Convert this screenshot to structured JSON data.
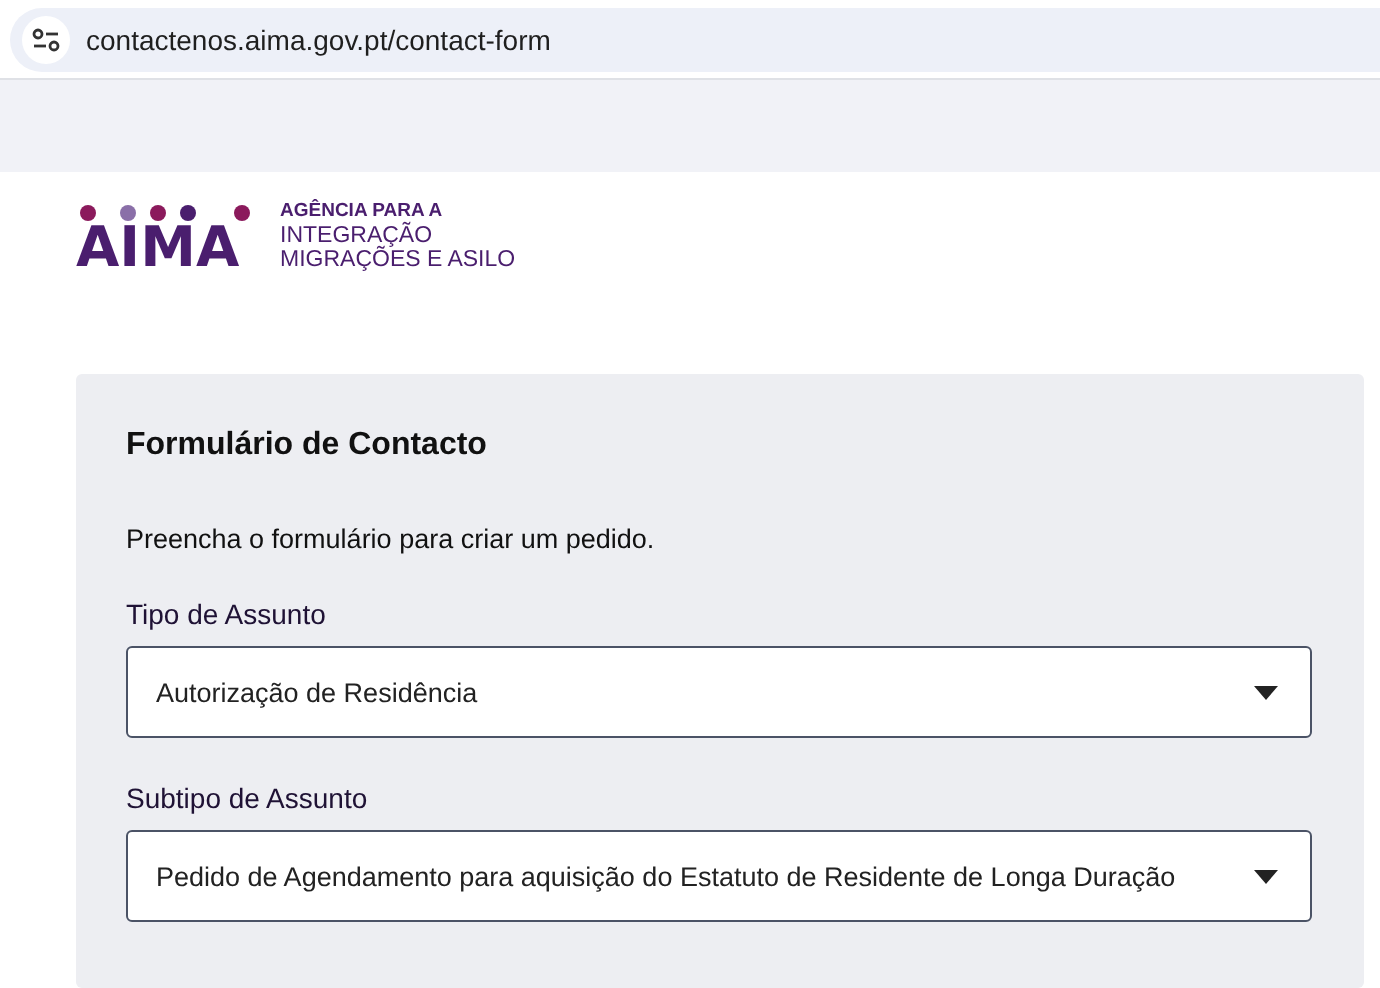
{
  "address_bar": {
    "url": "contactenos.aima.gov.pt/contact-form"
  },
  "logo": {
    "wordmark": "AIMA",
    "lines": [
      "AGÊNCIA PARA A",
      "INTEGRAÇÃO",
      "MIGRAÇÕES E ASILO"
    ]
  },
  "form": {
    "title": "Formulário de Contacto",
    "intro": "Preencha o formulário para criar um pedido.",
    "fields": [
      {
        "label": "Tipo de Assunto",
        "value": "Autorização de Residência"
      },
      {
        "label": "Subtipo de Assunto",
        "value": "Pedido de Agendamento para aquisição do Estatuto de Residente de Longa Duração"
      }
    ]
  }
}
